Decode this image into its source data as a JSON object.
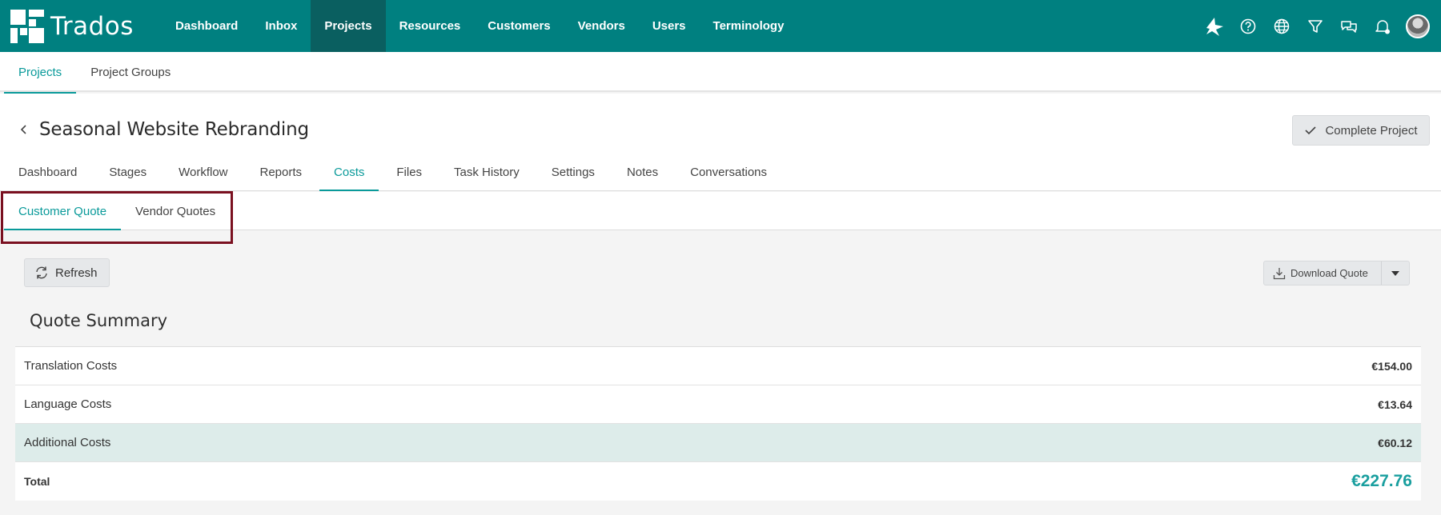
{
  "brand": {
    "name": "Trados",
    "accent": "#008080",
    "teal": "#0a9a9a"
  },
  "nav": {
    "items": [
      {
        "label": "Dashboard"
      },
      {
        "label": "Inbox"
      },
      {
        "label": "Projects",
        "active": true
      },
      {
        "label": "Resources"
      },
      {
        "label": "Customers"
      },
      {
        "label": "Vendors"
      },
      {
        "label": "Users"
      },
      {
        "label": "Terminology"
      }
    ],
    "icons": [
      "bird-icon",
      "help-icon",
      "globe-icon",
      "filter-icon",
      "chat-icon",
      "notification-bell-icon",
      "user-avatar"
    ]
  },
  "subnav": {
    "items": [
      {
        "label": "Projects",
        "active": true
      },
      {
        "label": "Project Groups"
      }
    ]
  },
  "project": {
    "title": "Seasonal Website Rebranding",
    "complete_label": "Complete Project",
    "tabs": [
      {
        "label": "Dashboard"
      },
      {
        "label": "Stages"
      },
      {
        "label": "Workflow"
      },
      {
        "label": "Reports"
      },
      {
        "label": "Costs",
        "active": true
      },
      {
        "label": "Files"
      },
      {
        "label": "Task History"
      },
      {
        "label": "Settings"
      },
      {
        "label": "Notes"
      },
      {
        "label": "Conversations"
      }
    ]
  },
  "costs": {
    "tabs": [
      {
        "label": "Customer Quote",
        "active": true
      },
      {
        "label": "Vendor Quotes"
      }
    ],
    "refresh_label": "Refresh",
    "download_label": "Download Quote",
    "summary": {
      "title": "Quote Summary",
      "rows": [
        {
          "label": "Translation Costs",
          "amount": "€154.00"
        },
        {
          "label": "Language Costs",
          "amount": "€13.64"
        },
        {
          "label": "Additional Costs",
          "amount": "€60.12"
        }
      ],
      "total_label": "Total",
      "total_amount": "€227.76"
    }
  }
}
